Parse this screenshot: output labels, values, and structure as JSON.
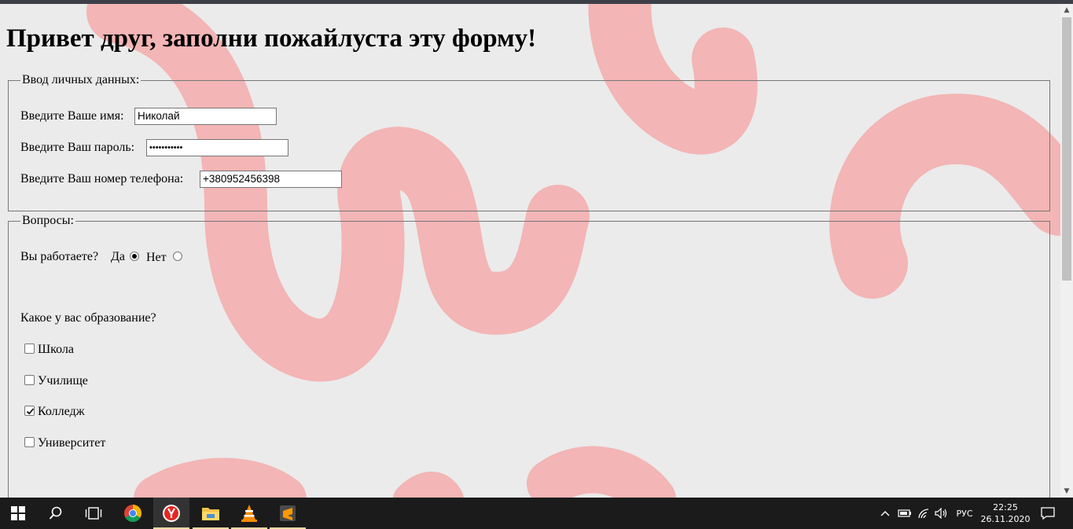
{
  "page": {
    "heading": "Привет друг, заполни пожайлуста эту форму!"
  },
  "personal": {
    "legend": "Ввод личных данных:",
    "name_label": "Введите Ваше имя:",
    "name_value": "Николай",
    "password_label": "Введите Ваш пароль:",
    "password_masked": "•••••••••••",
    "phone_label": "Введите Ваш номер телефона:",
    "phone_value": "+380952456398"
  },
  "questions": {
    "legend": "Вопросы:",
    "work_question": "Вы работаете?",
    "yes_label": "Да",
    "no_label": "Нет",
    "work_selected": "Да",
    "education_question": "Какое у вас образование?",
    "education_options": [
      {
        "label": "Школа",
        "checked": false
      },
      {
        "label": "Училище",
        "checked": false
      },
      {
        "label": "Колледж",
        "checked": true
      },
      {
        "label": "Университет",
        "checked": false
      }
    ]
  },
  "taskbar": {
    "apps": [
      "start-icon",
      "search-icon",
      "task-view-icon",
      "chrome-icon",
      "yandex-browser-icon",
      "file-explorer-icon",
      "vlc-icon",
      "sublime-text-icon"
    ],
    "tray": {
      "language": "РУС",
      "time": "22:25",
      "date": "26.11.2020"
    }
  },
  "colors": {
    "background": "#ebebeb",
    "brush_stroke": "#f2aaaa",
    "taskbar": "#1b1b1b"
  }
}
